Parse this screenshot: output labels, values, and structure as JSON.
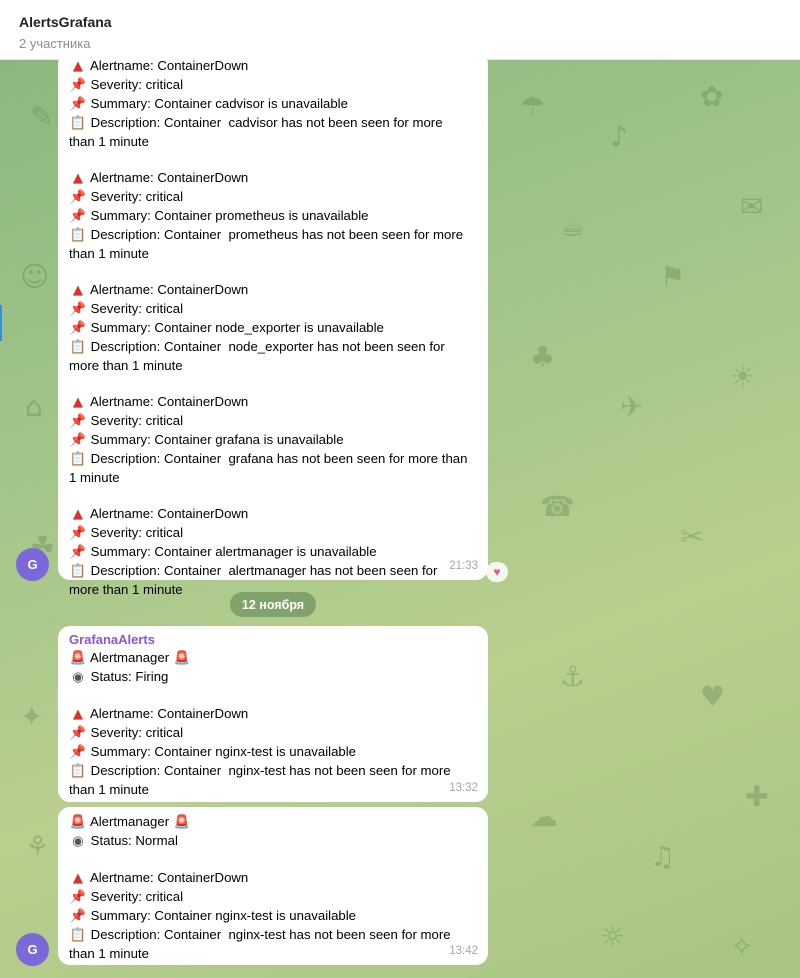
{
  "header": {
    "title": "AlertsGrafana",
    "subtitle": "2 участника"
  },
  "messages": [
    {
      "time": "21:33",
      "lines": [
        "Alertname: ContainerDown",
        "Severity: critical",
        "Summary: Container cadvisor is unavailable",
        "Description: Container  cadvisor has not been seen for more",
        "than 1 minute",
        "",
        "Alertname: ContainerDown",
        "Severity: critical",
        "Summary: Container prometheus is unavailable",
        "Description: Container  prometheus has not been seen for more",
        "than 1 minute",
        "",
        "Alertname: ContainerDown",
        "Severity: critical",
        "Summary: Container node_exporter is unavailable",
        "Description: Container  node_exporter has not been seen for",
        "more than 1 minute",
        "",
        "Alertname: ContainerDown",
        "Severity: critical",
        "Summary: Container grafana is unavailable",
        "Description: Container  grafana has not been seen for more than",
        "1 minute",
        "",
        "Alertname: ContainerDown",
        "Severity: critical",
        "Summary: Container alertmanager is unavailable",
        "Description: Container  alertmanager has not been seen for",
        "more than 1 minute"
      ],
      "avatar": "G",
      "reaction": "heart"
    },
    {
      "date_label": "12 ноября",
      "sender": "GrafanaAlerts",
      "time": "13:32",
      "lines": [
        "Alertmanager",
        "Status: Firing",
        "",
        "Alertname: ContainerDown",
        "Severity: critical",
        "Summary: Container nginx-test is unavailable",
        "Description: Container  nginx-test has not been seen for more",
        "than 1 minute"
      ]
    },
    {
      "time": "13:42",
      "avatar": "G",
      "lines": [
        "Alertmanager",
        "Status: Normal",
        "",
        "Alertname: ContainerDown",
        "Severity: critical",
        "Summary: Container nginx-test is unavailable",
        "Description: Container  nginx-test has not been seen for more",
        "than 1 minute"
      ]
    }
  ],
  "icons": {
    "alertname": "red-triangle-icon",
    "severity": "pushpin-icon",
    "summary": "pushpin-icon",
    "description": "clipboard-icon",
    "alertmanager": "siren-icon",
    "status": "radio-button-icon",
    "reaction": "heart-icon"
  },
  "colors": {
    "sender": "#8b57cc",
    "avatar": "#7b68d9",
    "date_pill": "#6f9460"
  }
}
